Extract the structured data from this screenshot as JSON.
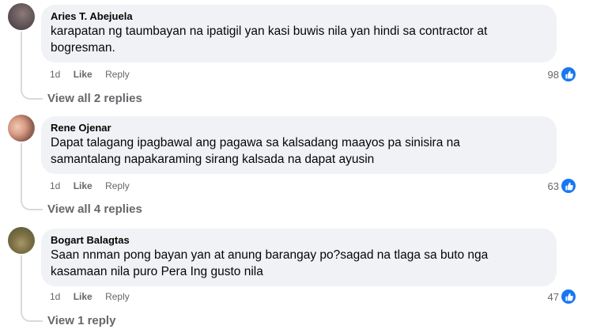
{
  "comments": [
    {
      "author": "Aries T. Abejuela",
      "text": "karapatan ng taumbayan na ipatigil yan kasi buwis nila yan hindi sa contractor at bogresman.",
      "time": "1d",
      "like": "Like",
      "reply": "Reply",
      "reaction_count": "98",
      "view_replies": "View all 2 replies"
    },
    {
      "author": "Rene Ojenar",
      "text": "Dapat talagang ipagbawal ang pagawa sa kalsadang maayos pa sinisira na samantalang napakaraming sirang kalsada na dapat ayusin",
      "time": "1d",
      "like": "Like",
      "reply": "Reply",
      "reaction_count": "63",
      "view_replies": "View all 4 replies"
    },
    {
      "author": "Bogart Balagtas",
      "text": "Saan nnman pong bayan yan at anung barangay po?sagad na tlaga sa buto nga kasamaan nila puro Pera Ing gusto nila",
      "time": "1d",
      "like": "Like",
      "reply": "Reply",
      "reaction_count": "47",
      "view_replies": "View 1 reply"
    }
  ],
  "colors": {
    "bubble": "#f0f2f5",
    "secondary_text": "#65676b",
    "like_blue": "#1877f2"
  },
  "icons": {
    "reaction": "thumbs-up-icon"
  }
}
